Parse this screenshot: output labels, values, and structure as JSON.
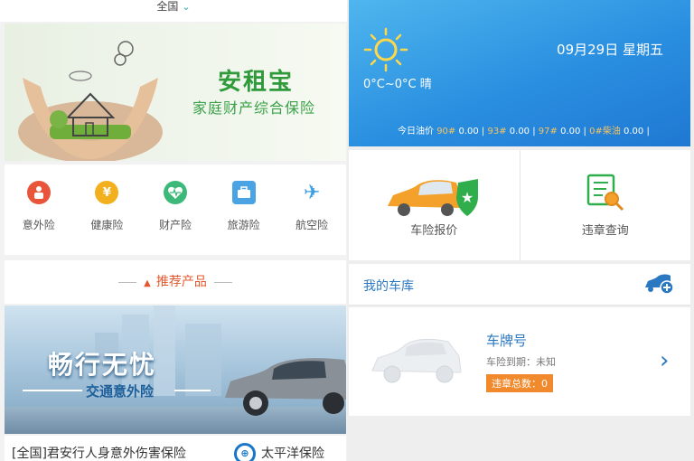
{
  "left": {
    "region": "全国",
    "hero": {
      "title": "安租宝",
      "subtitle": "家庭财产综合保险"
    },
    "categories": [
      {
        "label": "意外险",
        "icon": "person-icon",
        "color": "#e8553b"
      },
      {
        "label": "健康险",
        "icon": "yen-icon",
        "color": "#f2b01e"
      },
      {
        "label": "财产险",
        "icon": "heart-pulse-icon",
        "color": "#3cb878"
      },
      {
        "label": "旅游险",
        "icon": "suitcase-icon",
        "color": "#4aa3e2"
      },
      {
        "label": "航空险",
        "icon": "airplane-icon",
        "color": "#3d9fe0"
      }
    ],
    "recommend": {
      "label": "推荐产品"
    },
    "banner": {
      "title": "畅行无忧",
      "subtitle": "交通意外险"
    },
    "product": {
      "name": "[全国]君安行人身意外伤害保险",
      "brand": "太平洋保险"
    }
  },
  "right": {
    "weather": {
      "icon": "sun-icon",
      "temp": "0°C~0°C 晴",
      "date": "09月29日 星期五",
      "oil_label": "今日油价",
      "oil": [
        {
          "k": "90#",
          "v": "0.00"
        },
        {
          "k": "93#",
          "v": "0.00"
        },
        {
          "k": "97#",
          "v": "0.00"
        },
        {
          "k": "0#柴油",
          "v": "0.00"
        }
      ]
    },
    "quick": [
      {
        "label": "车险报价",
        "icon": "car-shield-icon"
      },
      {
        "label": "违章查询",
        "icon": "document-search-icon"
      }
    ],
    "garage": {
      "title": "我的车库",
      "plate": "车牌号",
      "expire": "车险到期：未知",
      "violations": "违章总数：0"
    }
  }
}
